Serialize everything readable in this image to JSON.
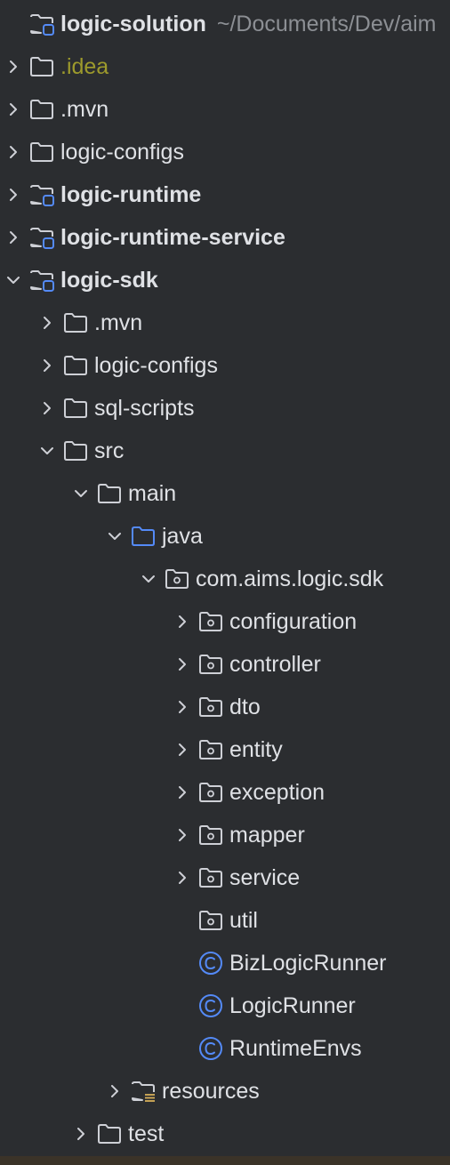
{
  "project": {
    "name": "logic-solution",
    "path": "~/Documents/Dev/aim"
  },
  "tree": [
    {
      "label": "logic-solution",
      "hint": "~/Documents/Dev/aim",
      "level": 0,
      "chevron": "none",
      "icon": "module-folder-icon",
      "style": "bold"
    },
    {
      "label": ".idea",
      "level": 0,
      "chevron": "right",
      "icon": "folder-icon",
      "style": "excluded"
    },
    {
      "label": ".mvn",
      "level": 0,
      "chevron": "right",
      "icon": "folder-icon",
      "style": "normal"
    },
    {
      "label": "logic-configs",
      "level": 0,
      "chevron": "right",
      "icon": "folder-icon",
      "style": "normal"
    },
    {
      "label": "logic-runtime",
      "level": 0,
      "chevron": "right",
      "icon": "module-folder-icon",
      "style": "bold"
    },
    {
      "label": "logic-runtime-service",
      "level": 0,
      "chevron": "right",
      "icon": "module-folder-icon",
      "style": "bold"
    },
    {
      "label": "logic-sdk",
      "level": 0,
      "chevron": "down",
      "icon": "module-folder-icon",
      "style": "bold"
    },
    {
      "label": ".mvn",
      "level": 1,
      "chevron": "right",
      "icon": "folder-icon",
      "style": "normal"
    },
    {
      "label": "logic-configs",
      "level": 1,
      "chevron": "right",
      "icon": "folder-icon",
      "style": "normal"
    },
    {
      "label": "sql-scripts",
      "level": 1,
      "chevron": "right",
      "icon": "folder-icon",
      "style": "normal"
    },
    {
      "label": "src",
      "level": 1,
      "chevron": "down",
      "icon": "folder-icon",
      "style": "normal"
    },
    {
      "label": "main",
      "level": 2,
      "chevron": "down",
      "icon": "folder-icon",
      "style": "normal"
    },
    {
      "label": "java",
      "level": 3,
      "chevron": "down",
      "icon": "source-folder-icon",
      "style": "normal"
    },
    {
      "label": "com.aims.logic.sdk",
      "level": 4,
      "chevron": "down",
      "icon": "package-icon",
      "style": "normal"
    },
    {
      "label": "configuration",
      "level": 5,
      "chevron": "right",
      "icon": "package-icon",
      "style": "normal"
    },
    {
      "label": "controller",
      "level": 5,
      "chevron": "right",
      "icon": "package-icon",
      "style": "normal"
    },
    {
      "label": "dto",
      "level": 5,
      "chevron": "right",
      "icon": "package-icon",
      "style": "normal"
    },
    {
      "label": "entity",
      "level": 5,
      "chevron": "right",
      "icon": "package-icon",
      "style": "normal"
    },
    {
      "label": "exception",
      "level": 5,
      "chevron": "right",
      "icon": "package-icon",
      "style": "normal"
    },
    {
      "label": "mapper",
      "level": 5,
      "chevron": "right",
      "icon": "package-icon",
      "style": "normal"
    },
    {
      "label": "service",
      "level": 5,
      "chevron": "right",
      "icon": "package-icon",
      "style": "normal"
    },
    {
      "label": "util",
      "level": 5,
      "chevron": "none",
      "icon": "package-icon",
      "style": "normal"
    },
    {
      "label": "BizLogicRunner",
      "level": 5,
      "chevron": "none",
      "icon": "java-class-icon",
      "style": "normal"
    },
    {
      "label": "LogicRunner",
      "level": 5,
      "chevron": "none",
      "icon": "java-class-icon",
      "style": "normal"
    },
    {
      "label": "RuntimeEnvs",
      "level": 5,
      "chevron": "none",
      "icon": "java-class-icon",
      "style": "normal"
    },
    {
      "label": "resources",
      "level": 3,
      "chevron": "right",
      "icon": "resources-folder-icon",
      "style": "normal"
    },
    {
      "label": "test",
      "level": 2,
      "chevron": "right",
      "icon": "folder-icon",
      "style": "normal"
    }
  ],
  "colors": {
    "background": "#2b2d30",
    "text": "#dfe1e5",
    "hint": "#8c8f94",
    "excluded": "#9d9a2c",
    "accent": "#548af7",
    "icon_outline": "#ced0d6",
    "resources_accent": "#d6ae58"
  }
}
